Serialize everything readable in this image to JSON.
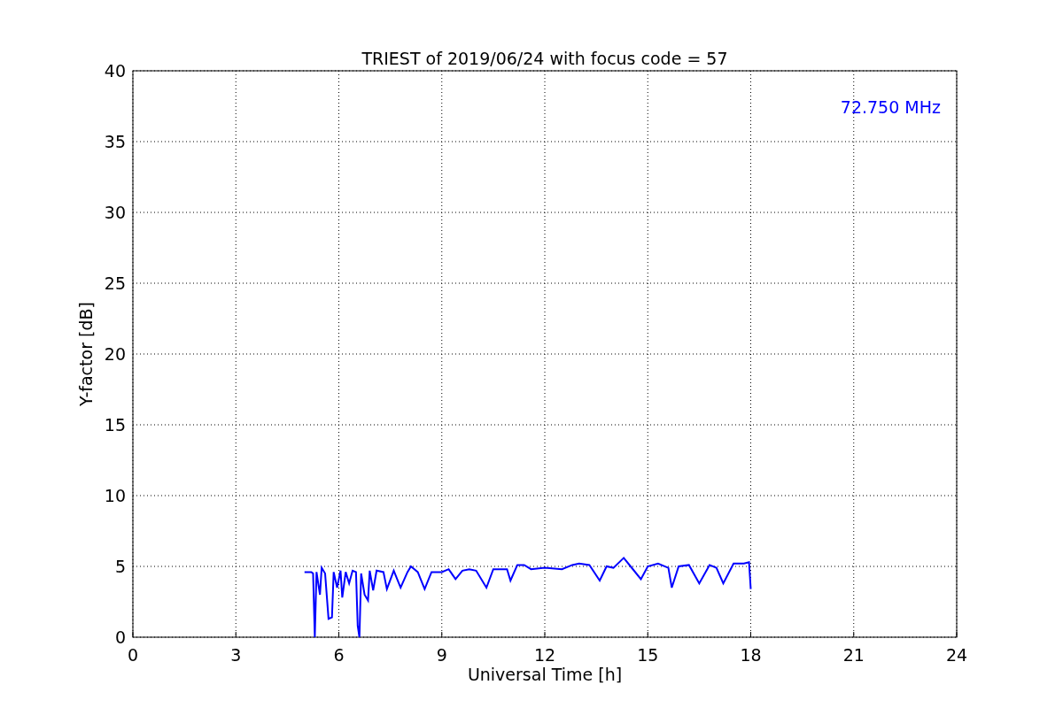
{
  "figure": {
    "chart_data": {
      "type": "line",
      "title": "TRIEST of 2019/06/24 with focus code = 57",
      "xlabel": "Universal Time [h]",
      "ylabel": "Y-factor [dB]",
      "x": [
        5.0,
        5.2,
        5.25,
        5.3,
        5.35,
        5.45,
        5.5,
        5.6,
        5.7,
        5.8,
        5.85,
        5.95,
        6.05,
        6.1,
        6.2,
        6.3,
        6.4,
        6.5,
        6.55,
        6.6,
        6.65,
        6.75,
        6.85,
        6.9,
        7.0,
        7.1,
        7.3,
        7.4,
        7.6,
        7.8,
        8.0,
        8.1,
        8.3,
        8.5,
        8.7,
        9.0,
        9.2,
        9.4,
        9.6,
        9.8,
        10.0,
        10.3,
        10.5,
        10.9,
        11.0,
        11.2,
        11.4,
        11.6,
        12.0,
        12.5,
        12.8,
        13.0,
        13.3,
        13.6,
        13.8,
        14.0,
        14.3,
        14.5,
        14.8,
        15.0,
        15.3,
        15.6,
        15.7,
        15.9,
        16.2,
        16.5,
        16.8,
        17.0,
        17.2,
        17.5,
        17.8,
        17.95,
        18.0
      ],
      "series": [
        {
          "name": "72.750 MHz",
          "color": "#0000ff",
          "values": [
            4.6,
            4.6,
            4.5,
            0.0,
            4.6,
            3.0,
            4.9,
            4.5,
            1.3,
            1.4,
            4.6,
            3.5,
            4.7,
            2.8,
            4.6,
            3.8,
            4.7,
            4.6,
            0.8,
            0.0,
            4.5,
            3.0,
            2.6,
            4.7,
            3.3,
            4.7,
            4.6,
            3.4,
            4.7,
            3.5,
            4.6,
            5.0,
            4.6,
            3.4,
            4.6,
            4.6,
            4.8,
            4.1,
            4.7,
            4.8,
            4.7,
            3.5,
            4.8,
            4.8,
            4.0,
            5.1,
            5.1,
            4.8,
            4.9,
            4.8,
            5.1,
            5.2,
            5.1,
            4.0,
            5.0,
            4.9,
            5.6,
            5.0,
            4.1,
            5.0,
            5.2,
            4.9,
            3.5,
            5.0,
            5.1,
            3.8,
            5.1,
            4.9,
            3.8,
            5.2,
            5.2,
            5.3,
            3.4
          ]
        }
      ],
      "xlim": [
        0,
        24
      ],
      "ylim": [
        0,
        40
      ],
      "xticks": [
        0,
        3,
        6,
        9,
        12,
        15,
        18,
        21,
        24
      ],
      "yticks": [
        0,
        5,
        10,
        15,
        20,
        25,
        30,
        35,
        40
      ],
      "grid": true
    }
  }
}
